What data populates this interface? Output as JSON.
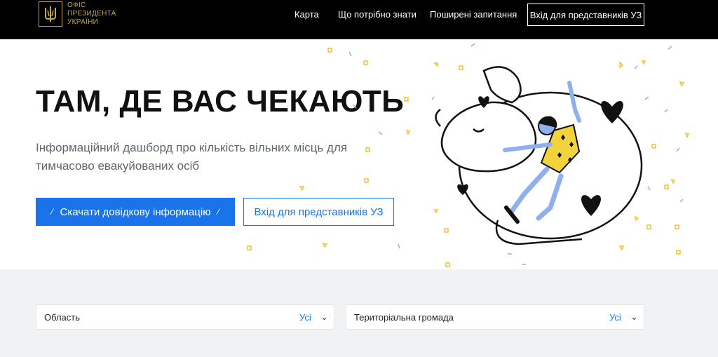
{
  "header": {
    "logo_lines": [
      "ОФІС",
      "ПРЕЗИДЕНТА",
      "УКРАЇНИ"
    ],
    "nav": [
      {
        "label": "Карта"
      },
      {
        "label": "Що потрібно знати"
      },
      {
        "label": "Поширені запитання"
      }
    ],
    "login_button": "Вхід для представників УЗ"
  },
  "hero": {
    "title": "ТАМ, ДЕ ВАС ЧЕКАЮТЬ",
    "subtitle": "Інформаційний дашборд про кількість вільних місць для тимчасово евакуйованих осіб",
    "download_button": "Скачати довідкову інформацію",
    "login_button": "Вхід для представників УЗ"
  },
  "filters": {
    "region": {
      "label": "Область",
      "value": "Усі"
    },
    "community": {
      "label": "Територіальна громада",
      "value": "Усі"
    }
  },
  "colors": {
    "brand_blue": "#1a73e8",
    "header_black": "#000000",
    "gold": "#c8a84e",
    "accent_yellow": "#f2d33c",
    "light_blue": "#8fb0f0"
  }
}
